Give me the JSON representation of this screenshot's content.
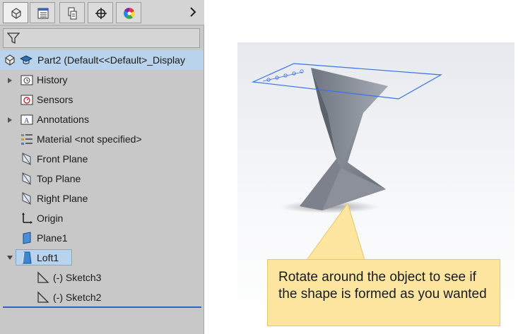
{
  "tabs": [
    {
      "name": "feature-manager",
      "icon": "feature-tree-icon",
      "active": true
    },
    {
      "name": "property-manager",
      "icon": "property-list-icon",
      "active": false
    },
    {
      "name": "configuration-manager",
      "icon": "configuration-icon",
      "active": false
    },
    {
      "name": "dimxpert-manager",
      "icon": "crosshair-icon",
      "active": false
    },
    {
      "name": "display-manager",
      "icon": "color-wheel-icon",
      "active": false
    }
  ],
  "tree": {
    "root": "Part2  (Default<<Default>_Display",
    "items": [
      {
        "label": "History",
        "icon": "history-folder-icon",
        "expandable": true
      },
      {
        "label": "Sensors",
        "icon": "sensors-folder-icon",
        "expandable": false
      },
      {
        "label": "Annotations",
        "icon": "annotations-folder-icon",
        "expandable": true
      },
      {
        "label": "Material <not specified>",
        "icon": "material-icon",
        "expandable": false
      },
      {
        "label": "Front Plane",
        "icon": "plane-icon",
        "expandable": false
      },
      {
        "label": "Top Plane",
        "icon": "plane-icon",
        "expandable": false
      },
      {
        "label": "Right Plane",
        "icon": "plane-icon",
        "expandable": false
      },
      {
        "label": "Origin",
        "icon": "origin-icon",
        "expandable": false
      },
      {
        "label": "Plane1",
        "icon": "plane-icon",
        "expandable": false
      },
      {
        "label": "Loft1",
        "icon": "loft-feature-icon",
        "expandable": true,
        "expanded": true,
        "selected": true
      },
      {
        "label": "(-) Sketch3",
        "icon": "sketch-icon",
        "child": true
      },
      {
        "label": "(-) Sketch2",
        "icon": "sketch-icon",
        "child": true
      }
    ]
  },
  "callout": {
    "text": "Rotate around the object to see if the shape is formed as you wanted"
  },
  "colors": {
    "panel_bg": "#c8c8c8",
    "selection": "#b9d3ec",
    "accent_line": "#2f67b8",
    "callout_bg": "#fee6a0",
    "plane_outline": "#3b72e8",
    "model_face": "#8d929c"
  }
}
